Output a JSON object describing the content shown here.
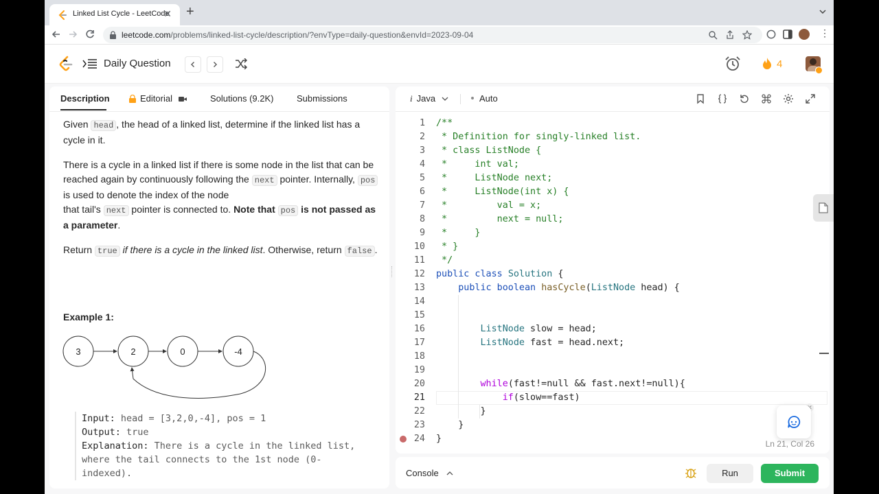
{
  "browser": {
    "tab_title": "Linked List Cycle - LeetCode",
    "url_host": "leetcode.com",
    "url_path": "/problems/linked-list-cycle/description/?envType=daily-question&envId=2023-09-04"
  },
  "header": {
    "title": "Daily Question",
    "streak_count": "4"
  },
  "left_tabs": {
    "description": "Description",
    "editorial": "Editorial",
    "solutions": "Solutions (9.2K)",
    "submissions": "Submissions"
  },
  "problem": {
    "p1_a": "Given ",
    "p1_code": "head",
    "p1_b": ", the head of a linked list, determine if the linked list has a cycle in it.",
    "p2_a": "There is a cycle in a linked list if there is some node in the list that can be reached again by continuously following the ",
    "p2_code1": "next",
    "p2_b": " pointer. Internally, ",
    "p2_code2": "pos",
    "p2_c": " is used to denote the index of the node",
    "p2_d": "that tail's ",
    "p2_code3": "next",
    "p2_e": " pointer is connected to. ",
    "p2_bold1": "Note that",
    "p2_code4": "pos",
    "p2_bold2": " is not passed as a parameter",
    "p2_f": ".",
    "p3_a": "Return ",
    "p3_code1": "true",
    "p3_italic": " if there is a cycle in the linked list",
    "p3_b": ". Otherwise, return ",
    "p3_code2": "false",
    "p3_c": ".",
    "example_title": "Example 1:",
    "nodes": [
      "3",
      "2",
      "0",
      "-4"
    ],
    "input_label": "Input:",
    "input_value": " head = [3,2,0,-4], pos = 1",
    "output_label": "Output:",
    "output_value": " true",
    "explanation_label": "Explanation:",
    "explanation_value": " There is a cycle in the linked list,",
    "explanation_line2": "where the tail connects to the 1st node (0-",
    "explanation_line3": "indexed)."
  },
  "editor": {
    "language": "Java",
    "mode": "Auto",
    "line_numbers": [
      "1",
      "2",
      "3",
      "4",
      "5",
      "6",
      "7",
      "8",
      "9",
      "10",
      "11",
      "12",
      "13",
      "14",
      "15",
      "16",
      "17",
      "18",
      "19",
      "20",
      "21",
      "22",
      "23",
      "24"
    ],
    "code": {
      "l1": "/**",
      "l2": " * Definition for singly-linked list.",
      "l3": " * class ListNode {",
      "l4": " *     int val;",
      "l5": " *     ListNode next;",
      "l6": " *     ListNode(int x) {",
      "l7": " *         val = x;",
      "l8": " *         next = null;",
      "l9": " *     }",
      "l10": " * }",
      "l11": " */",
      "l12_kw": "public class",
      "l12_ty": "Solution",
      "l12_rest": " {",
      "l13_kw": "public boolean",
      "l13_fn": "hasCycle",
      "l13_p": "(",
      "l13_ty": "ListNode",
      "l13_rest": " head) {",
      "l16_ty": "ListNode",
      "l16_rest": " slow = head;",
      "l17_ty": "ListNode",
      "l17_rest": " fast = head.next;",
      "l20_kw": "while",
      "l20_rest": "(fast!=null && fast.next!=null){",
      "l21_kw": "if",
      "l21_rest": "(slow==fast)",
      "l22": "}",
      "l23": "}",
      "l24": "}"
    },
    "cursor_position": "Ln 21, Col 26"
  },
  "console": {
    "label": "Console",
    "run": "Run",
    "submit": "Submit"
  },
  "colors": {
    "accent": "#ffa116",
    "submit_green": "#2db55d",
    "comment_green": "#267f26",
    "keyword_blue": "#1c4fb8",
    "type_teal": "#26747f"
  }
}
